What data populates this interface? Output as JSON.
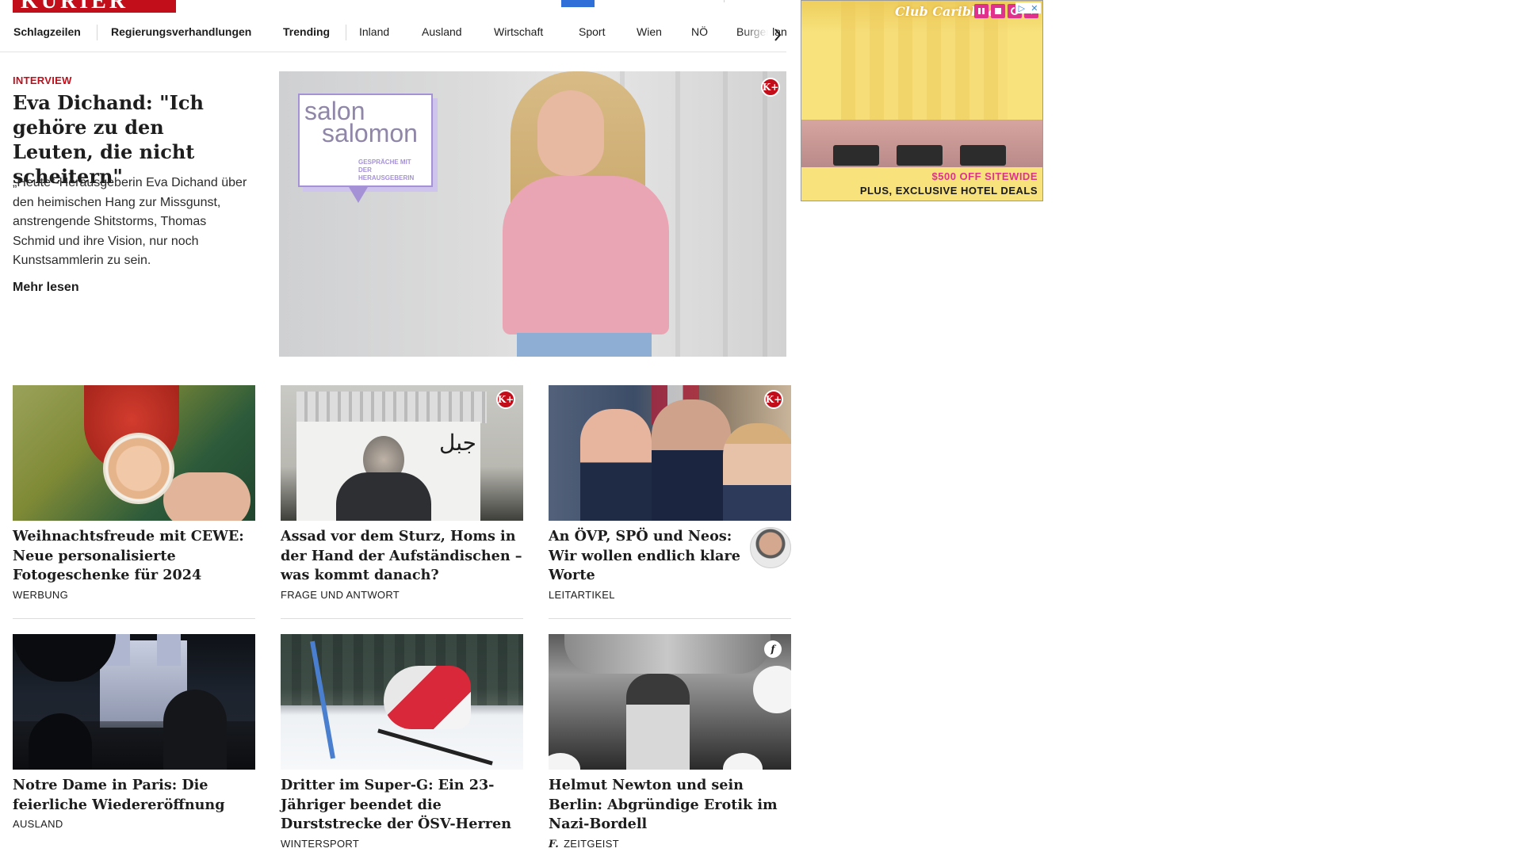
{
  "header": {
    "logo_text": "KURIER"
  },
  "nav": {
    "items": [
      {
        "label": "Schlagzeilen",
        "bold": true
      },
      {
        "label": "Regierungsverhandlungen",
        "bold": true
      },
      {
        "label": "Trending",
        "bold": true
      },
      {
        "label": "Inland",
        "bold": false
      },
      {
        "label": "Ausland",
        "bold": false
      },
      {
        "label": "Wirtschaft",
        "bold": false
      },
      {
        "label": "Sport",
        "bold": false
      },
      {
        "label": "Wien",
        "bold": false
      },
      {
        "label": "NÖ",
        "bold": false
      },
      {
        "label": "Burgenland",
        "bold": false
      }
    ],
    "next_icon": "chevron-right-icon"
  },
  "hero": {
    "kicker": "INTERVIEW",
    "title": "Eva Dichand: \"Ich gehöre zu den Leuten, die nicht scheitern\"",
    "lead": "„Heute“-Herausgeberin Eva Dichand über den heimischen Hang zur Missgunst, anstrengende Shitstorms, Thomas Schmid und ihre Vision, nur noch Kunstsammlerin zu sein.",
    "more": "Mehr lesen",
    "badge": "K+",
    "salon_line1": "salon",
    "salon_line2": "salomon",
    "salon_sub": "GESPRÄCHE MIT DER HERAUSGEBERIN"
  },
  "ad": {
    "logo": "Club Caribbean",
    "line1": "$500 OFF SITEWIDE",
    "line2": "PLUS, EXCLUSIVE HOTEL DEALS",
    "controls": [
      "pause-icon",
      "stop-icon",
      "replay-icon",
      "mute-icon"
    ],
    "adchoices_icon": "adchoices-icon",
    "close_icon": "close-icon"
  },
  "articles": [
    {
      "title": "Weihnachtsfreude mit CEWE: Neue personalisierte Fotogeschenke für 2024",
      "category": "WERBUNG",
      "badge": ""
    },
    {
      "title": "Assad vor dem Sturz, Homs in der Hand der Aufständischen – was kommt danach?",
      "category": "FRAGE UND ANTWORT",
      "badge": "K+"
    },
    {
      "title": "An ÖVP, SPÖ und Neos: Wir wollen endlich klare Worte",
      "category": "LEITARTIKEL",
      "badge": "K+"
    },
    {
      "title": "Notre Dame in Paris: Die feierliche Wiedereröffnung",
      "category": "AUSLAND",
      "badge": ""
    },
    {
      "title": "Dritter im Super-G: Ein 23-Jähriger beendet die Durststrecke der ÖSV-Herren",
      "category": "WINTERSPORT",
      "badge": ""
    },
    {
      "title": "Helmut Newton und sein Berlin: Abgründige Erotik im Nazi-Bordell",
      "category": "ZEITGEIST",
      "badge": "f"
    }
  ],
  "colors": {
    "brand_red": "#c20e1a",
    "ad_pink": "#e0328c",
    "salon_purple": "#a592d6"
  }
}
